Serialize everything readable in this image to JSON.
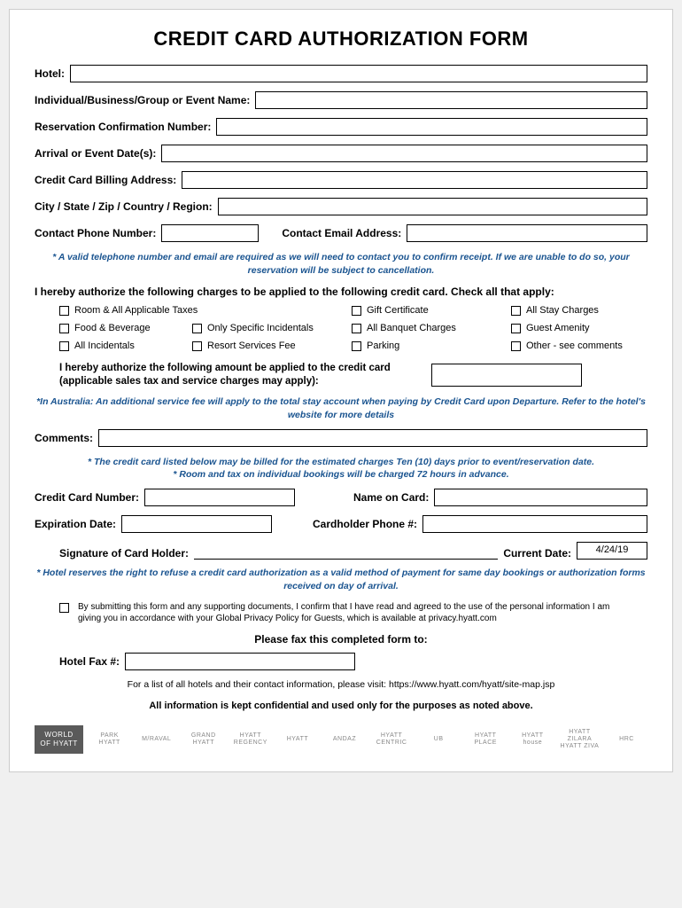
{
  "title": "CREDIT CARD AUTHORIZATION FORM",
  "fields": {
    "hotel": "Hotel:",
    "name": "Individual/Business/Group or Event Name:",
    "reservation": "Reservation Confirmation Number:",
    "arrival": "Arrival or Event Date(s):",
    "billing": "Credit Card Billing Address:",
    "citystate": "City / State / Zip / Country / Region:",
    "phone": "Contact Phone Number:",
    "email": "Contact Email Address:"
  },
  "note1": "* A valid telephone number and email are required as we will need to contact you to confirm receipt. If we are unable to do so, your reservation will be subject to cancellation.",
  "authorize_charges": "I hereby authorize the following charges to be applied to the following credit card.  Check all that apply:",
  "checks": [
    "Room & All Applicable Taxes",
    "",
    "Gift Certificate",
    "All Stay Charges",
    "Food & Beverage",
    "Only Specific Incidentals",
    "All Banquet Charges",
    "Guest Amenity",
    "All Incidentals",
    "Resort Services Fee",
    "Parking",
    "Other - see comments"
  ],
  "authorize_amount": "I hereby authorize the following amount be applied to the credit card (applicable sales tax and service charges may apply):",
  "note2": "*In Australia: An additional service fee will apply to the total stay account when paying by Credit Card upon Departure. Refer to the hotel's website for more details",
  "comments_label": "Comments:",
  "note3a": "* The credit card listed below may be billed for the estimated charges Ten (10) days prior to event/reservation date.",
  "note3b": "* Room and tax on individual bookings will be charged 72 hours in advance.",
  "cc": {
    "number": "Credit Card Number:",
    "name": "Name on Card:",
    "exp": "Expiration Date:",
    "phone": "Cardholder Phone #:",
    "signature": "Signature of Card Holder:",
    "date_label": "Current Date:",
    "date_value": "4/24/19"
  },
  "note4": "* Hotel reserves the right to refuse a credit card authorization as a valid method of payment for same day bookings or authorization forms received on day of arrival.",
  "privacy": "By submitting this form and any supporting documents, I confirm that I have read and agreed to the use of the personal information I am giving you in accordance with your Global Privacy Policy for Guests, which is available at privacy.hyatt.com",
  "fax_title": "Please fax this completed form to:",
  "fax_label": "Hotel Fax #:",
  "hotel_list": "For a list of all hotels and their contact information, please visit: https://www.hyatt.com/hyatt/site-map.jsp",
  "confidential": "All information is kept confidential and used only for the purposes as noted above.",
  "logos": [
    "WORLD\nOF\nHYATT",
    "PARK HYATT",
    "M/RAVAL",
    "GRAND\nHYATT",
    "HYATT\nREGENCY",
    "HYATT",
    "ANDAZ",
    "HYATT\nCENTRIC",
    "UB",
    "HYATT\nPLACE",
    "HYATT\nhouse",
    "HYATT ZILARA\nHYATT ZIVA",
    "HRC"
  ]
}
